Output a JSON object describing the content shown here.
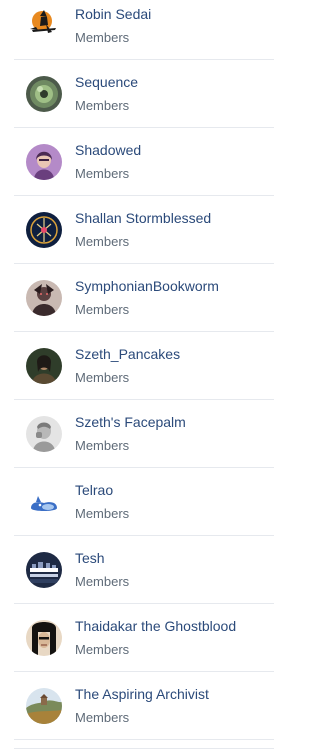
{
  "members": [
    {
      "name": "Robin Sedai",
      "group": "Members",
      "avatar": "witch-silhouette-avatar"
    },
    {
      "name": "Sequence",
      "group": "Members",
      "avatar": "green-orb-avatar"
    },
    {
      "name": "Shadowed",
      "group": "Members",
      "avatar": "purple-portrait-avatar"
    },
    {
      "name": "Shallan Stormblessed",
      "group": "Members",
      "avatar": "glyph-sigil-avatar"
    },
    {
      "name": "SymphonianBookworm",
      "group": "Members",
      "avatar": "dark-figure-avatar"
    },
    {
      "name": "Szeth_Pancakes",
      "group": "Members",
      "avatar": "painted-portrait-avatar"
    },
    {
      "name": "Szeth's Facepalm",
      "group": "Members",
      "avatar": "grey-bust-avatar"
    },
    {
      "name": "Telrao",
      "group": "Members",
      "avatar": "blue-creature-avatar"
    },
    {
      "name": "Tesh",
      "group": "Members",
      "avatar": "city-skyline-avatar"
    },
    {
      "name": "Thaidakar the Ghostblood",
      "group": "Members",
      "avatar": "masked-face-avatar"
    },
    {
      "name": "The Aspiring Archivist",
      "group": "Members",
      "avatar": "landscape-avatar"
    }
  ]
}
